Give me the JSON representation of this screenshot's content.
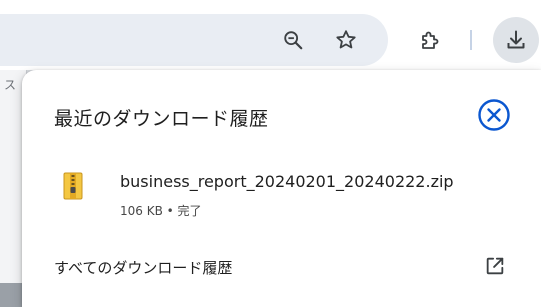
{
  "toolbar": {
    "icons": [
      "zoom-out-icon",
      "bookmark-star-icon",
      "extensions-icon",
      "download-icon"
    ]
  },
  "page_behind": {
    "fragment_text": "ス"
  },
  "download_popup": {
    "title": "最近のダウンロード履歴",
    "close_icon": "close-circle-icon",
    "files": [
      {
        "name": "business_report_20240201_20240222.zip",
        "size": "106 KB",
        "status": "完了",
        "meta": "106 KB • 完了",
        "icon": "zip-archive-icon"
      }
    ],
    "all_history_label": "すべてのダウンロード履歴",
    "open_external_icon": "open-in-new-icon"
  },
  "colors": {
    "accent": "#0b57d0",
    "text": "#1f1f1f",
    "secondary_text": "#474747",
    "omnibox_bg": "#e9edf3",
    "download_button_bg": "#dfe3e8"
  }
}
